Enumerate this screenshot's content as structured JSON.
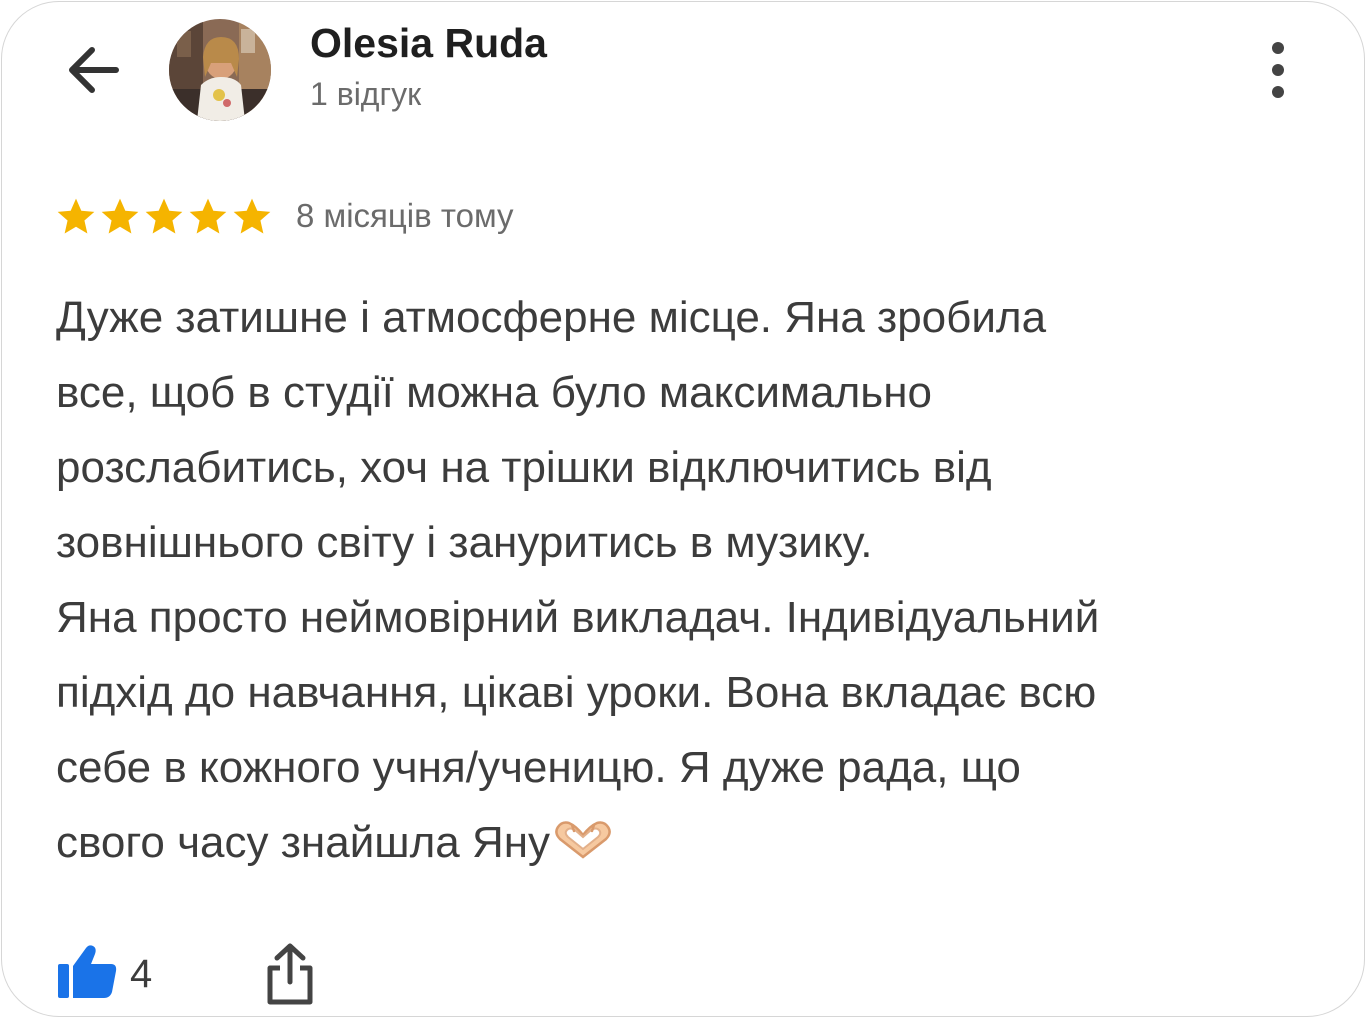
{
  "reviewer": {
    "name": "Olesia Ruda",
    "review_count": "1 відгук"
  },
  "icons": {
    "back": "arrow-left-icon",
    "more": "more-vertical-icon",
    "star": "star-icon",
    "like": "thumbs-up-icon",
    "share": "share-icon",
    "emoji": "heart-hands-emoji"
  },
  "review": {
    "rating": 5,
    "rating_max": 5,
    "date": "8 місяців тому",
    "lines": [
      "Дуже затишне і атмосферне місце. Яна зробила",
      "все, щоб в студії можна було максимально",
      "розслабитись, хоч на трішки відключитись від",
      "зовнішнього світу і зануритись в музику.",
      "Яна просто неймовірний викладач. Індивідуальний",
      "підхід до навчання, цікаві уроки. Вона вкладає всю",
      "себе в кожного учня/ученицю. Я дуже рада, що",
      "свого часу знайшла Яну"
    ]
  },
  "actions": {
    "like_count": "4"
  },
  "colors": {
    "star": "#f5b400",
    "like": "#1a73e8",
    "text": "#3c3c3c",
    "muted": "#6b6b6b",
    "name": "#1f1f1f"
  }
}
